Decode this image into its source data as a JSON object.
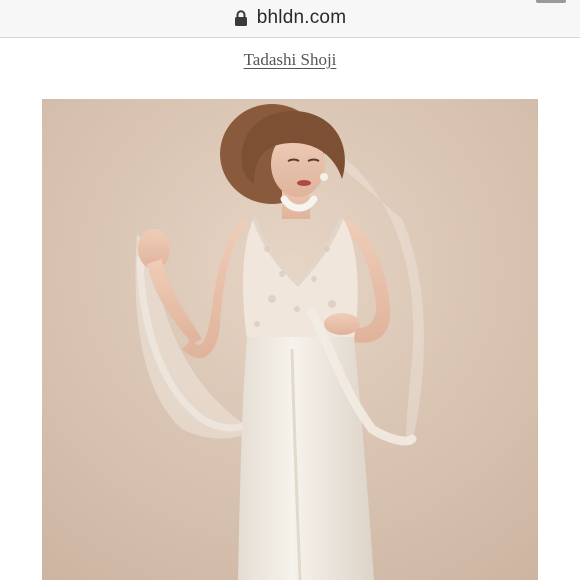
{
  "browser": {
    "url": "bhldn.com",
    "lock_icon": "lock-icon"
  },
  "product": {
    "brand": "Tadashi Shoji",
    "image": {
      "background": "#dcc7b6",
      "dress_color": "#f1ebe2"
    }
  }
}
